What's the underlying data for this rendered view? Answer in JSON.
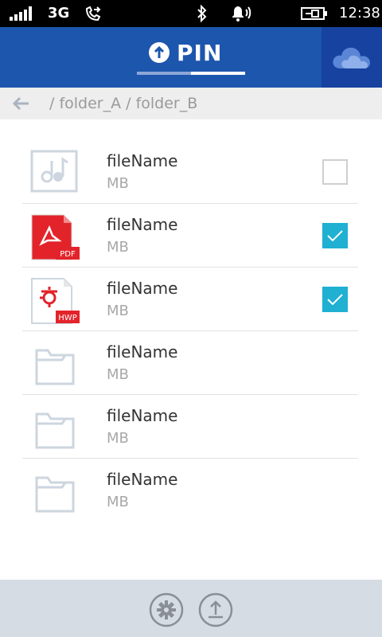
{
  "status_bar": {
    "network": "3G",
    "time": "12:38",
    "icons": [
      "signal-icon",
      "call-forward-icon",
      "bluetooth-icon",
      "ringer-icon",
      "battery-charging-icon"
    ]
  },
  "header": {
    "title": "PIN",
    "title_icon": "upload-circle-icon",
    "cloud_icon": "onedrive-cloud-icon",
    "colors": {
      "header_bg": "#1d56ad",
      "cloud_bg": "#1742a0",
      "accent": "#1fb0d2"
    }
  },
  "breadcrumb": {
    "back_icon": "back-arrow-icon",
    "path": "/ folder_A / folder_B"
  },
  "files": [
    {
      "name": "fileName",
      "size": "MB",
      "type": "music",
      "icon": "music-file-icon",
      "checkbox": "unchecked"
    },
    {
      "name": "fileName",
      "size": "MB",
      "type": "pdf",
      "icon": "pdf-file-icon",
      "badge": "PDF",
      "checkbox": "checked"
    },
    {
      "name": "fileName",
      "size": "MB",
      "type": "hwp",
      "icon": "hwp-file-icon",
      "badge": "HWP",
      "checkbox": "checked"
    },
    {
      "name": "fileName",
      "size": "MB",
      "type": "folder",
      "icon": "folder-icon"
    },
    {
      "name": "fileName",
      "size": "MB",
      "type": "folder",
      "icon": "folder-icon"
    },
    {
      "name": "fileName",
      "size": "MB",
      "type": "folder",
      "icon": "folder-icon"
    }
  ],
  "bottom_bar": {
    "buttons": [
      "settings-icon",
      "upload-icon"
    ]
  }
}
